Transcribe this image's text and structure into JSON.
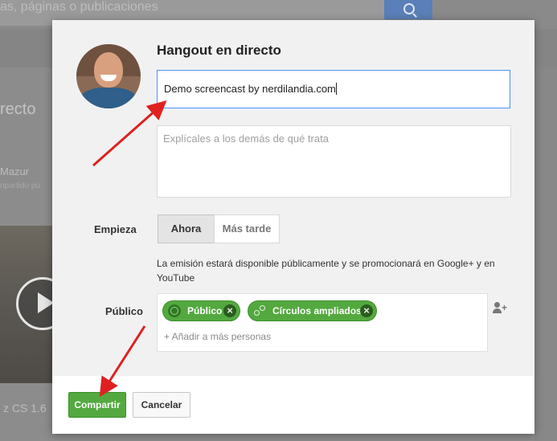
{
  "background": {
    "search_placeholder": "as, páginas o publicaciones",
    "section_title": "recto",
    "author_name": "Mazur",
    "author_meta": "npartido pú",
    "video_caption": "z CS 1.6"
  },
  "dialog": {
    "title": "Hangout en directo",
    "title_input_value": "Demo screencast by nerdilandia.com",
    "description_placeholder": "Explícales a los demás de qué trata",
    "starts_label": "Empieza",
    "starts_options": [
      "Ahora",
      "Más tarde"
    ],
    "starts_selected": "Ahora",
    "notice": "La emisión estará disponible públicamente y se promocionará en Google+ y en YouTube",
    "audience_label": "Público",
    "audience_chips": [
      "Público",
      "Círculos ampliados"
    ],
    "add_people_placeholder": "+ Añadir a más personas",
    "share_button": "Compartir",
    "cancel_button": "Cancelar"
  },
  "colors": {
    "accent_green": "#53a93f",
    "focus_blue": "#4d90fe",
    "annotation_red": "#e02020"
  },
  "icons": [
    "search-icon",
    "globe-icon",
    "circles-icon",
    "close-icon",
    "add-person-icon",
    "play-icon"
  ]
}
